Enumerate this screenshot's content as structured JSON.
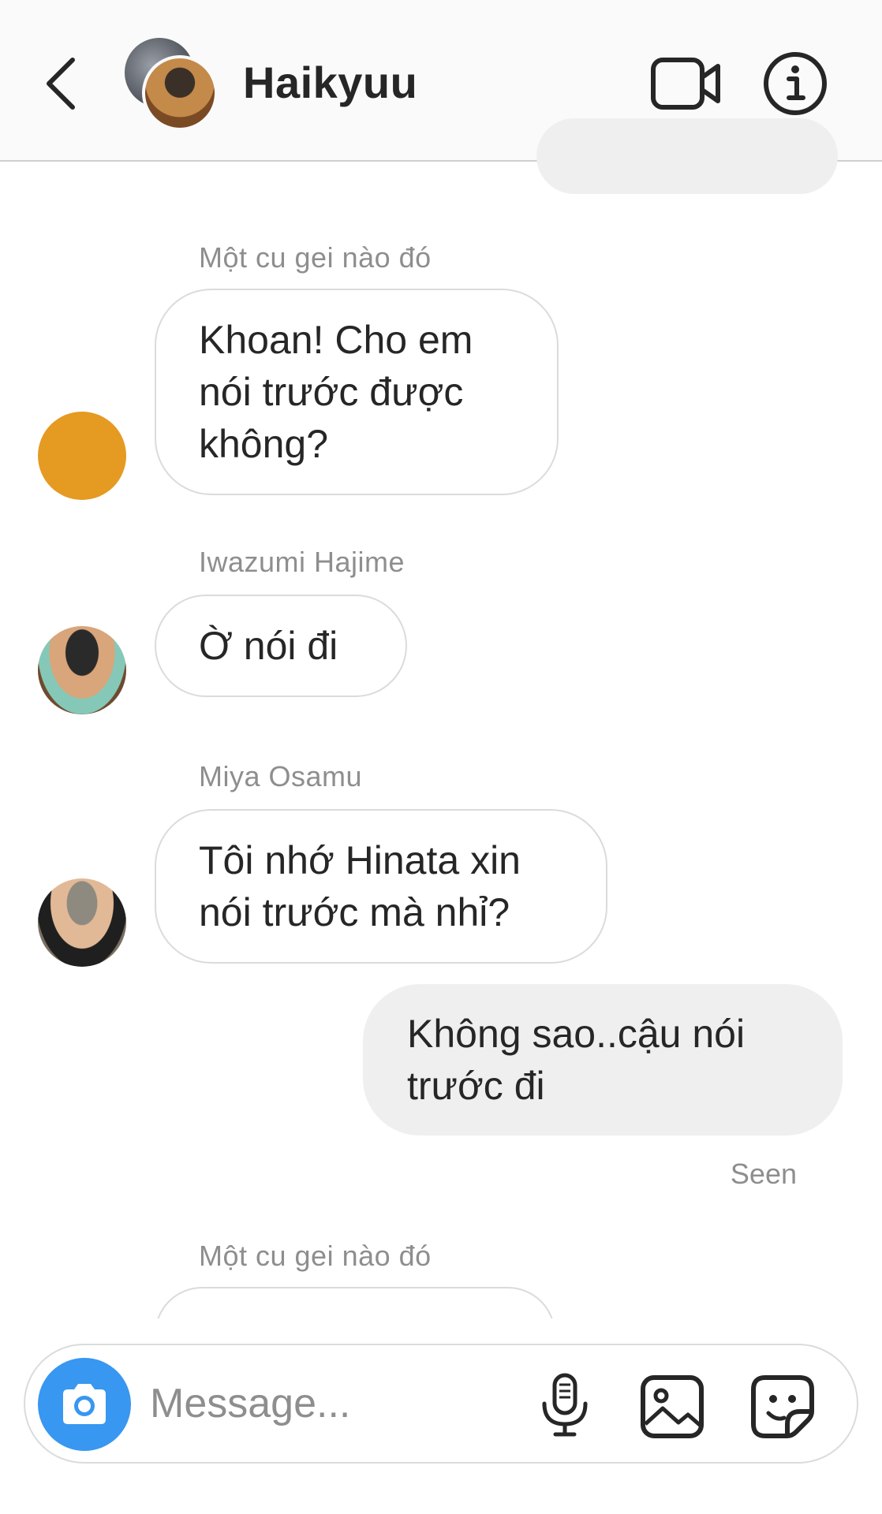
{
  "header": {
    "title": "Haikyuu"
  },
  "messages": [
    {
      "sender": "Một cu gei nào đó",
      "text_lines": [
        "Khoan! Cho em",
        "nói trước được",
        "không?"
      ]
    },
    {
      "sender": "Iwazumi Hajime",
      "text_lines": [
        "Ờ nói đi"
      ]
    },
    {
      "sender": "Miya Osamu",
      "text_lines": [
        "Tôi nhớ Hinata xin",
        "nói trước mà nhỉ?"
      ]
    },
    {
      "outgoing": true,
      "text_lines": [
        "Không sao..cậu nói",
        "trước đi"
      ]
    },
    {
      "sender": "Một cu gei nào đó",
      "text_lines": []
    }
  ],
  "status": {
    "seen": "Seen"
  },
  "composer": {
    "placeholder": "Message..."
  },
  "icons": {
    "back": "chevron-left-icon",
    "video": "video-camera-icon",
    "info": "info-icon",
    "camera": "camera-icon",
    "mic": "microphone-icon",
    "gallery": "image-icon",
    "sticker": "sticker-icon"
  },
  "colors": {
    "accent": "#3897f0",
    "outgoing_bubble": "#efefef",
    "muted_text": "#8e8e8e",
    "avatar_orange": "#e59a22"
  }
}
